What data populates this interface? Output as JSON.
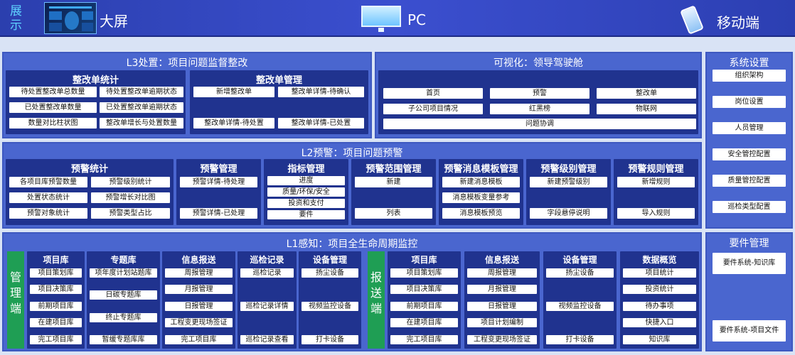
{
  "header": {
    "show_label": "展示",
    "bigscreen_label": "大屏",
    "pc_label": "PC",
    "mobile_label": "移动端"
  },
  "l3": {
    "title": "L3处置：项目问题监督整改",
    "stats": {
      "title": "整改单统计",
      "items": [
        "待处置整改单总数量",
        "待处置整改单逾期状态",
        "已处置整改单数量",
        "已处置整改单逾期状态",
        "数量对比柱状图",
        "整改单增长与处置数量"
      ]
    },
    "manage": {
      "title": "整改单管理",
      "items": [
        "新增整改单",
        "整改单详情-待确认",
        "整改单详情-待处置",
        "整改单详情-已处置"
      ]
    }
  },
  "viz": {
    "title": "可视化：领导驾驶舱",
    "items": [
      "首页",
      "预警",
      "整改单",
      "子公司项目情况",
      "红黑榜",
      "物联网",
      "问题协调"
    ]
  },
  "l2": {
    "title": "L2预警：项目问题预警",
    "panels": [
      {
        "title": "预警统计",
        "items": [
          "各项目库预警数量",
          "预警级别统计",
          "处置状态统计",
          "预警增长对比图",
          "预警对象统计",
          "预警类型占比"
        ]
      },
      {
        "title": "预警管理",
        "items": [
          "预警详情-待处理",
          "预警详情-已处理"
        ]
      },
      {
        "title": "指标管理",
        "items": [
          "进度",
          "质量/环保/安全",
          "投资和支付",
          "要件"
        ]
      },
      {
        "title": "预警范围管理",
        "items": [
          "新建",
          "列表"
        ]
      },
      {
        "title": "预警消息模板管理",
        "items": [
          "新建消息模板",
          "消息模板变量参考",
          "消息模板预览"
        ]
      },
      {
        "title": "预警级别管理",
        "items": [
          "新建预警级别",
          "字段悬停说明"
        ]
      },
      {
        "title": "预警规则管理",
        "items": [
          "新增规则",
          "导入规则"
        ]
      }
    ]
  },
  "l1": {
    "title": "L1感知：项目全生命周期监控",
    "management_label": "管理端",
    "reporting_label": "报送端",
    "panels": [
      {
        "title": "项目库",
        "items": [
          "项目策划库",
          "项目决策库",
          "前期项目库",
          "在建项目库",
          "完工项目库"
        ]
      },
      {
        "title": "专题库",
        "items": [
          "项年度计划站题库",
          "日碳专题库",
          "终止专题库",
          "暂缓专题库库"
        ]
      },
      {
        "title": "信息报送",
        "items": [
          "周报管理",
          "月报管理",
          "日报管理",
          "工程变更现场签证",
          "完工项目库"
        ]
      },
      {
        "title": "巡检记录",
        "items": [
          "巡检记录",
          "巡检记录详情",
          "巡检记录查看"
        ]
      },
      {
        "title": "设备管理",
        "items": [
          "扬尘设备",
          "视频监控设备",
          "打卡设备"
        ]
      },
      {
        "title": "项目库",
        "items": [
          "项目策划库",
          "项目决策库",
          "前期项目库",
          "在建项目库",
          "完工项目库"
        ]
      },
      {
        "title": "信息报送",
        "items": [
          "周报管理",
          "月报管理",
          "日报管理",
          "项目计划编制",
          "工程变更现场签证"
        ]
      },
      {
        "title": "设备管理",
        "items": [
          "扬尘设备",
          "视频监控设备",
          "打卡设备"
        ]
      },
      {
        "title": "数据概览",
        "items": [
          "项目统计",
          "投资统计",
          "待办事项",
          "快捷入口",
          "知识库"
        ]
      }
    ]
  },
  "settings": {
    "title": "系统设置",
    "items": [
      "组织架构",
      "岗位设置",
      "人员管理",
      "安全管控配置",
      "质量管控配置",
      "巡检类型配置"
    ]
  },
  "docs": {
    "title": "要件管理",
    "items": [
      "要件系统-知识库",
      "要件系统-项目文件"
    ]
  }
}
